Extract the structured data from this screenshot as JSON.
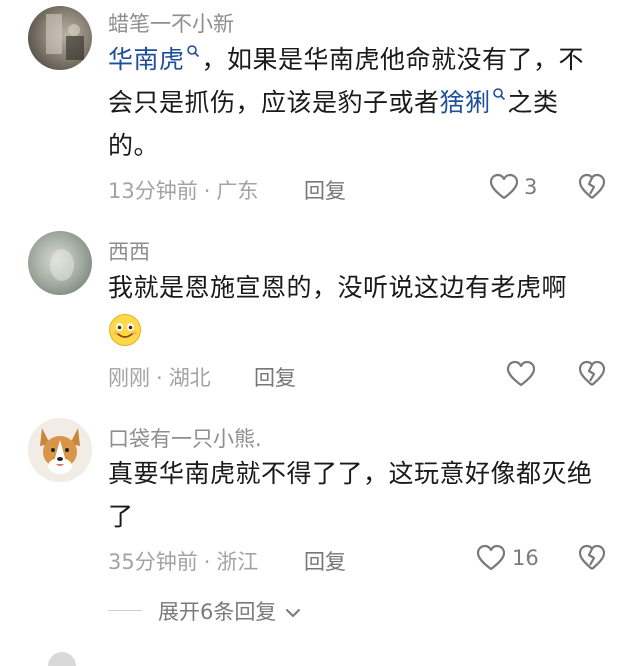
{
  "comments": [
    {
      "username": "蜡笔一不小新",
      "text": {
        "kw1": "华南虎",
        "mid1": "，如果是华南虎他命就没有了，不会只是抓伤，应该是豹子或者",
        "kw2": "猞猁",
        "end": "之类的。"
      },
      "time": "13分钟前",
      "location": "广东",
      "reply_label": "回复",
      "like_count": "3"
    },
    {
      "username": "西西",
      "text": "我就是恩施宣恩的，没听说这边有老虎啊",
      "emoji": "smiling-face-icon",
      "time": "刚刚",
      "location": "湖北",
      "reply_label": "回复"
    },
    {
      "username": "口袋有一只小熊.",
      "text": "真要华南虎就不得了了，这玩意好像都灭绝了",
      "time": "35分钟前",
      "location": "浙江",
      "reply_label": "回复",
      "like_count": "16"
    }
  ],
  "expand_replies_label": "展开6条回复",
  "colors": {
    "keyword": "#1f4f9a",
    "meta": "#a3a3a3",
    "text": "#1a1a1a"
  }
}
